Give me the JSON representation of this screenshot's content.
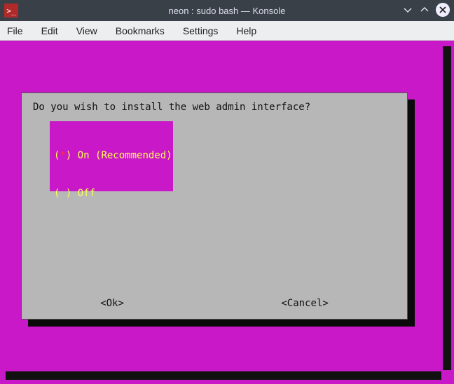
{
  "window": {
    "title": "neon : sudo bash — Konsole",
    "app_icon_text": ">_"
  },
  "menu": {
    "file": "File",
    "edit": "Edit",
    "view": "View",
    "bookmarks": "Bookmarks",
    "settings": "Settings",
    "help": "Help"
  },
  "dialog": {
    "prompt": "Do you wish to install the web admin interface?",
    "options": [
      {
        "mark_open": "(",
        "star": "*",
        "mark_close": ") ",
        "label": "On (Recommended)"
      },
      {
        "mark_open": "(",
        "star": " ",
        "mark_close": ") ",
        "label": "Off"
      }
    ],
    "ok": "<Ok>",
    "cancel": "<Cancel>"
  }
}
